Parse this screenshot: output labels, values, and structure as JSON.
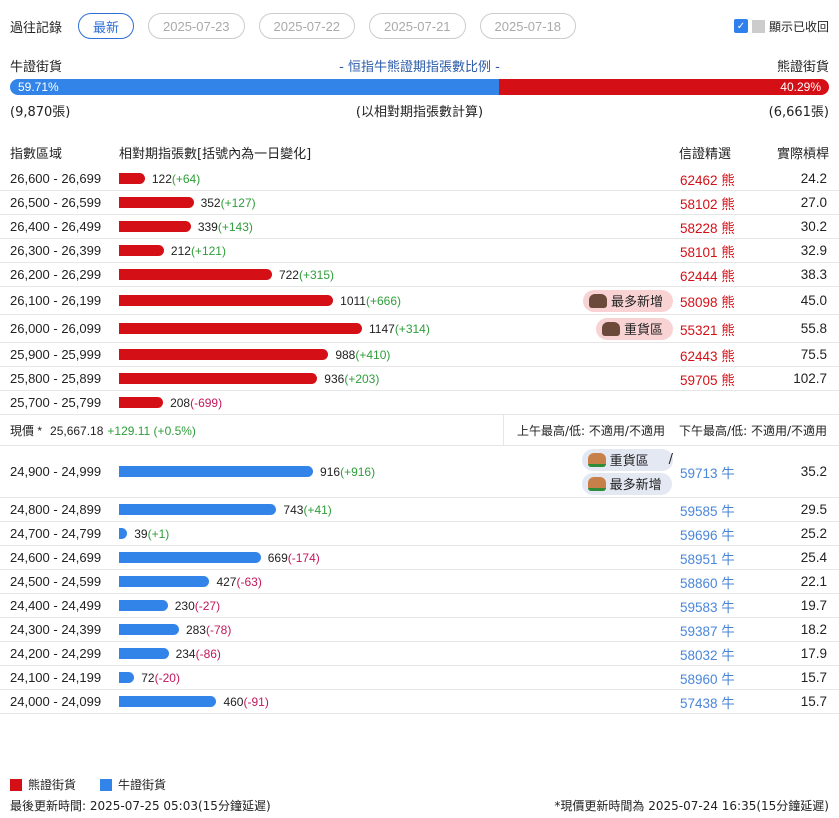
{
  "history": {
    "label": "過往記錄",
    "tabs": [
      "最新",
      "2025-07-23",
      "2025-07-22",
      "2025-07-21",
      "2025-07-18"
    ],
    "show_collapsed": "顯示已收回"
  },
  "ratio": {
    "bull_label": "牛證街貨",
    "title": "- 恒指牛熊證期指張數比例 -",
    "bear_label": "熊證街貨",
    "bull_pct": "59.71%",
    "bear_pct": "40.29%",
    "bull_fraction": 0.5971,
    "bull_count": "(9,870張)",
    "note": "(以相對期指張數計算)",
    "bear_count": "(6,661張)"
  },
  "table_header": {
    "range": "指數區域",
    "contracts": "相對期指張數[括號內為一日變化]",
    "pick": "信證精選",
    "leverage": "實際槓桿"
  },
  "colors": {
    "bear": "#d50f16",
    "bull": "#3384e8",
    "bear_code": "#d50f16",
    "bull_code": "#4a86d9"
  },
  "bear_rows": [
    {
      "range": "26,600 - 26,699",
      "count": 122,
      "count_text": "122",
      "change": "(+64)",
      "code": "62462 熊",
      "leverage": "24.2"
    },
    {
      "range": "26,500 - 26,599",
      "count": 352,
      "count_text": "352",
      "change": "(+127)",
      "code": "58102 熊",
      "leverage": "27.0"
    },
    {
      "range": "26,400 - 26,499",
      "count": 339,
      "count_text": "339",
      "change": "(+143)",
      "code": "58228 熊",
      "leverage": "30.2"
    },
    {
      "range": "26,300 - 26,399",
      "count": 212,
      "count_text": "212",
      "change": "(+121)",
      "code": "58101 熊",
      "leverage": "32.9"
    },
    {
      "range": "26,200 - 26,299",
      "count": 722,
      "count_text": "722",
      "change": "(+315)",
      "code": "62444 熊",
      "leverage": "38.3"
    },
    {
      "range": "26,100 - 26,199",
      "count": 1011,
      "count_text": "1011",
      "change": "(+666)",
      "code": "58098 熊",
      "leverage": "45.0",
      "badges": [
        "最多新增"
      ]
    },
    {
      "range": "26,000 - 26,099",
      "count": 1147,
      "count_text": "1147",
      "change": "(+314)",
      "code": "55321 熊",
      "leverage": "55.8",
      "badges": [
        "重貨區"
      ]
    },
    {
      "range": "25,900 - 25,999",
      "count": 988,
      "count_text": "988",
      "change": "(+410)",
      "code": "62443 熊",
      "leverage": "75.5"
    },
    {
      "range": "25,800 - 25,899",
      "count": 936,
      "count_text": "936",
      "change": "(+203)",
      "code": "59705 熊",
      "leverage": "102.7"
    },
    {
      "range": "25,700 - 25,799",
      "count": 208,
      "count_text": "208",
      "change": "(-699)",
      "code": "",
      "leverage": ""
    }
  ],
  "current": {
    "label": "現價 *",
    "price": "25,667.18",
    "change": "+129.11 (+0.5%)",
    "am": "上午最高/低: 不適用/不適用",
    "pm": "下午最高/低: 不適用/不適用"
  },
  "bull_rows": [
    {
      "range": "24,900 - 24,999",
      "count": 916,
      "count_text": "916",
      "change": "(+916)",
      "code": "59713 牛",
      "leverage": "35.2",
      "badges": [
        "重貨區",
        "最多新增"
      ],
      "badge_sep": "/"
    },
    {
      "range": "24,800 - 24,899",
      "count": 743,
      "count_text": "743",
      "change": "(+41)",
      "code": "59585 牛",
      "leverage": "29.5"
    },
    {
      "range": "24,700 - 24,799",
      "count": 39,
      "count_text": "39",
      "change": "(+1)",
      "code": "59696 牛",
      "leverage": "25.2"
    },
    {
      "range": "24,600 - 24,699",
      "count": 669,
      "count_text": "669",
      "change": "(-174)",
      "code": "58951 牛",
      "leverage": "25.4"
    },
    {
      "range": "24,500 - 24,599",
      "count": 427,
      "count_text": "427",
      "change": "(-63)",
      "code": "58860 牛",
      "leverage": "22.1"
    },
    {
      "range": "24,400 - 24,499",
      "count": 230,
      "count_text": "230",
      "change": "(-27)",
      "code": "59583 牛",
      "leverage": "19.7"
    },
    {
      "range": "24,300 - 24,399",
      "count": 283,
      "count_text": "283",
      "change": "(-78)",
      "code": "59387 牛",
      "leverage": "18.2"
    },
    {
      "range": "24,200 - 24,299",
      "count": 234,
      "count_text": "234",
      "change": "(-86)",
      "code": "58032 牛",
      "leverage": "17.9"
    },
    {
      "range": "24,100 - 24,199",
      "count": 72,
      "count_text": "72",
      "change": "(-20)",
      "code": "58960 牛",
      "leverage": "15.7"
    },
    {
      "range": "24,000 - 24,099",
      "count": 460,
      "count_text": "460",
      "change": "(-91)",
      "code": "57438 牛",
      "leverage": "15.7"
    }
  ],
  "legend": {
    "bear": "熊證街貨",
    "bull": "牛證街貨"
  },
  "footer": {
    "last_update": "最後更新時間: 2025-07-25 05:03(15分鐘延遲)",
    "price_update": "*現價更新時間為 2025-07-24 16:35(15分鐘延遲)"
  }
}
